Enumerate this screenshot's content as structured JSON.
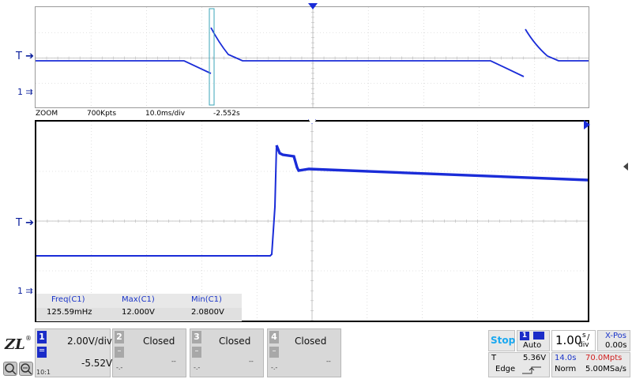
{
  "markers": {
    "trigger": "T",
    "ch1": "1"
  },
  "zoom_bar": {
    "mode": "ZOOM",
    "points": "700Kpts",
    "timebase": "10.0ms/div",
    "offset": "-2.552s"
  },
  "measurements": {
    "headers": [
      "Freq(C1)",
      "Max(C1)",
      "Min(C1)"
    ],
    "values": [
      "125.59mHz",
      "12.000V",
      "2.0800V"
    ]
  },
  "channels": [
    {
      "num": "1",
      "scale": "2.00V/div",
      "offset": "-5.52V",
      "coupling": "10:1"
    },
    {
      "num": "2",
      "status": "Closed",
      "left": "-.-",
      "right": "--"
    },
    {
      "num": "3",
      "status": "Closed",
      "left": "-.-",
      "right": "--"
    },
    {
      "num": "4",
      "status": "Closed",
      "left": "-.-",
      "right": "--"
    }
  ],
  "logo": {
    "mark": "ZLG",
    "registered": "®"
  },
  "run_state": {
    "label": "Stop",
    "color": "#1aa8f0"
  },
  "trigger": {
    "channel": "1",
    "mode": "Auto",
    "type_label": "T",
    "level": "5.36V",
    "slope_label": "Edge"
  },
  "timebase": {
    "scale": "1.00",
    "unit_top": "s",
    "unit_bottom": "div",
    "xpos_label": "X-Pos",
    "xpos_value": "0.00s"
  },
  "acquisition": {
    "record_time": "14.0s",
    "memory": "70.0Mpts",
    "mode": "Norm",
    "sample_rate": "5.00MSa/s"
  },
  "colors": {
    "trace": "#1a2cd8",
    "grid": "#c8c8c8",
    "marker": "#0a1e9c",
    "memory": "#d02020"
  }
}
